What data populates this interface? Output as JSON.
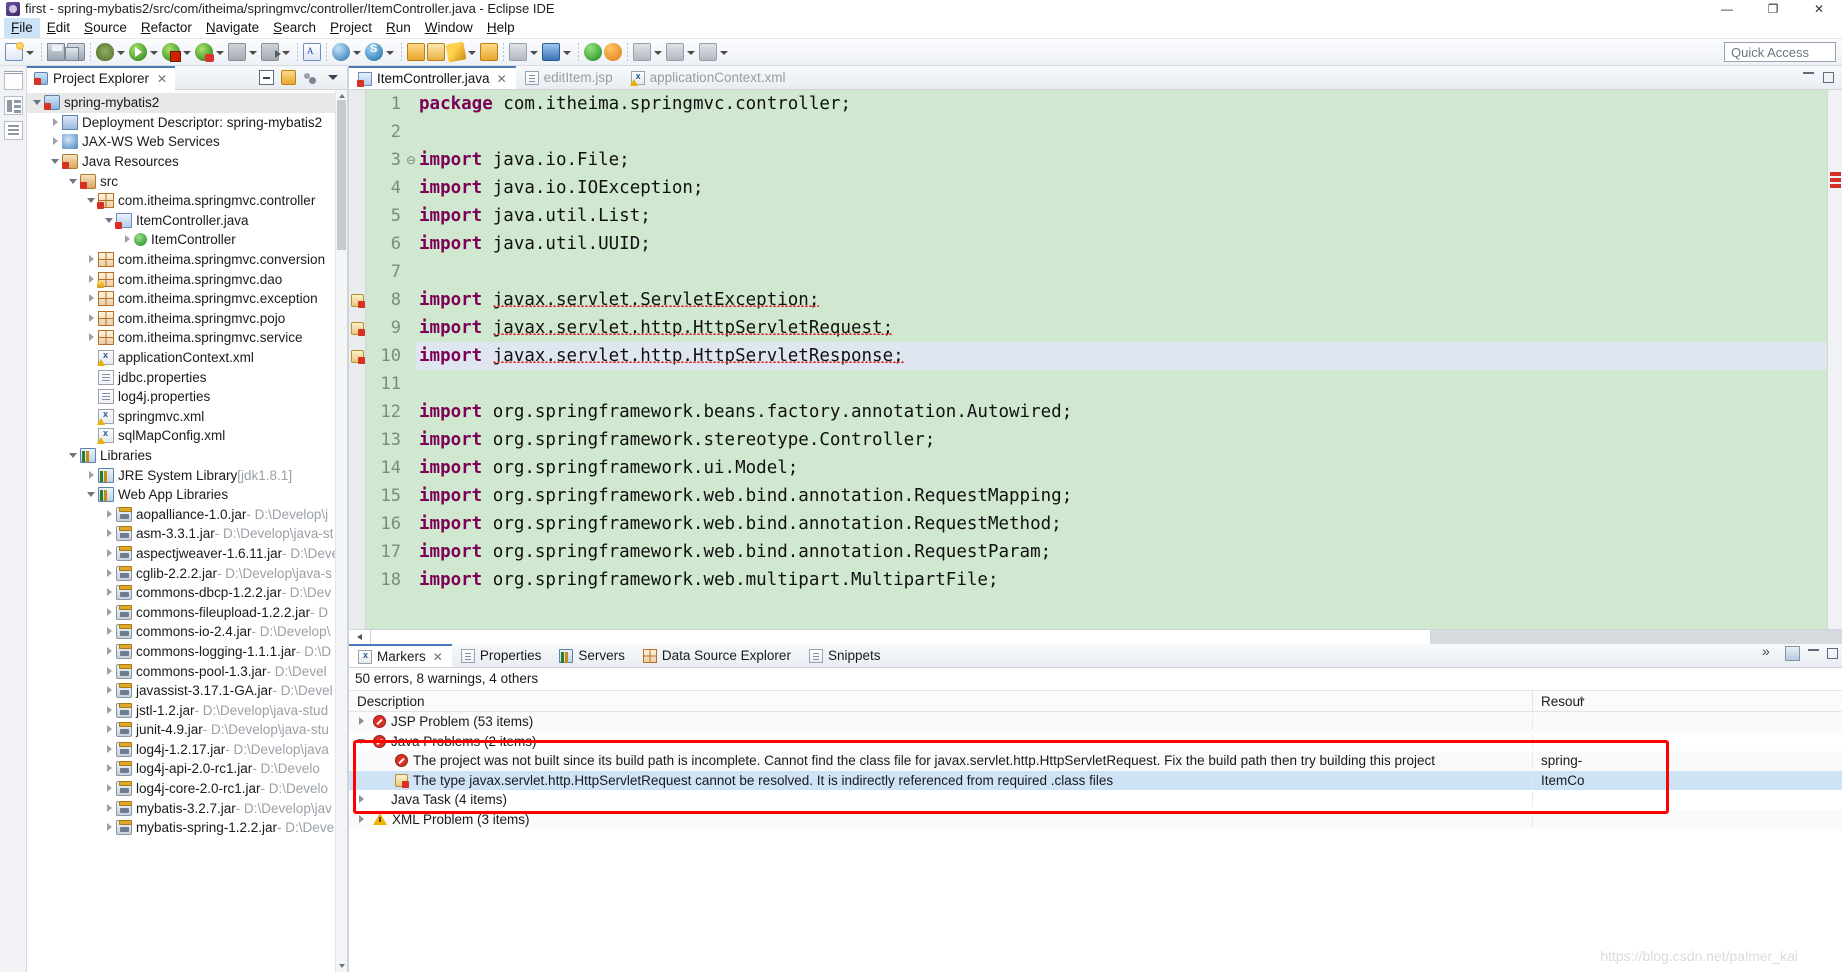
{
  "window": {
    "title": "first - spring-mybatis2/src/com/itheima/springmvc/controller/ItemController.java - Eclipse IDE",
    "minimize": "—",
    "maximize": "❐",
    "close": "✕"
  },
  "menubar": {
    "items": [
      {
        "label": "File",
        "active": true
      },
      {
        "label": "Edit",
        "active": false
      },
      {
        "label": "Source",
        "active": false
      },
      {
        "label": "Refactor",
        "active": false
      },
      {
        "label": "Navigate",
        "active": false
      },
      {
        "label": "Search",
        "active": false
      },
      {
        "label": "Project",
        "active": false
      },
      {
        "label": "Run",
        "active": false
      },
      {
        "label": "Window",
        "active": false
      },
      {
        "label": "Help",
        "active": false
      }
    ]
  },
  "toolbar": {
    "quick_access": "Quick Access",
    "icons": [
      "new-wizard-icon",
      "save-icon",
      "save-all-icon",
      "debug-icon",
      "run-icon",
      "run-configuration-icon",
      "run-as-server-icon",
      "terminate-icon",
      "step-icon",
      "new-java-class-icon",
      "open-type-icon",
      "search-icon",
      "open-resource-icon",
      "folder-icon",
      "pencil-icon",
      "open-perspective-icon"
    ]
  },
  "explorer": {
    "tab_label": "Project Explorer",
    "tab_close": "✕",
    "tools": [
      "collapse-all-icon",
      "link-with-editor-icon",
      "view-menu-dots-icon",
      "view-menu-icon"
    ],
    "tree": [
      {
        "indent": 0,
        "twisty": "expanded",
        "icon": "project-icon",
        "label": "spring-mybatis2",
        "path": "",
        "selected": true
      },
      {
        "indent": 1,
        "twisty": "collapsed",
        "icon": "deployment-descriptor-icon",
        "label": "Deployment Descriptor: spring-mybatis2",
        "path": ""
      },
      {
        "indent": 1,
        "twisty": "collapsed",
        "icon": "web-service-icon",
        "label": "JAX-WS Web Services",
        "path": ""
      },
      {
        "indent": 1,
        "twisty": "expanded",
        "icon": "java-resources-icon",
        "label": "Java Resources",
        "path": ""
      },
      {
        "indent": 2,
        "twisty": "expanded",
        "icon": "source-folder-icon",
        "label": "src",
        "path": ""
      },
      {
        "indent": 3,
        "twisty": "expanded",
        "icon": "package-error-icon",
        "label": "com.itheima.springmvc.controller",
        "path": ""
      },
      {
        "indent": 4,
        "twisty": "expanded",
        "icon": "java-file-error-icon",
        "label": "ItemController.java",
        "path": ""
      },
      {
        "indent": 5,
        "twisty": "collapsed",
        "icon": "class-icon",
        "label": "ItemController",
        "path": ""
      },
      {
        "indent": 3,
        "twisty": "collapsed",
        "icon": "package-icon",
        "label": "com.itheima.springmvc.conversion",
        "path": ""
      },
      {
        "indent": 3,
        "twisty": "collapsed",
        "icon": "package-lock-icon",
        "label": "com.itheima.springmvc.dao",
        "path": ""
      },
      {
        "indent": 3,
        "twisty": "collapsed",
        "icon": "package-icon",
        "label": "com.itheima.springmvc.exception",
        "path": ""
      },
      {
        "indent": 3,
        "twisty": "collapsed",
        "icon": "package-icon",
        "label": "com.itheima.springmvc.pojo",
        "path": ""
      },
      {
        "indent": 3,
        "twisty": "collapsed",
        "icon": "package-icon",
        "label": "com.itheima.springmvc.service",
        "path": ""
      },
      {
        "indent": 3,
        "twisty": "none",
        "icon": "xml-warning-icon",
        "label": "applicationContext.xml",
        "path": ""
      },
      {
        "indent": 3,
        "twisty": "none",
        "icon": "properties-icon",
        "label": "jdbc.properties",
        "path": ""
      },
      {
        "indent": 3,
        "twisty": "none",
        "icon": "properties-icon",
        "label": "log4j.properties",
        "path": ""
      },
      {
        "indent": 3,
        "twisty": "none",
        "icon": "xml-warning-icon",
        "label": "springmvc.xml",
        "path": ""
      },
      {
        "indent": 3,
        "twisty": "none",
        "icon": "xml-warning-icon",
        "label": "sqlMapConfig.xml",
        "path": ""
      },
      {
        "indent": 2,
        "twisty": "expanded",
        "icon": "library-icon",
        "label": "Libraries",
        "path": ""
      },
      {
        "indent": 3,
        "twisty": "collapsed",
        "icon": "library-icon",
        "label": "JRE System Library",
        "path": " [jdk1.8.1]"
      },
      {
        "indent": 3,
        "twisty": "expanded",
        "icon": "library-icon",
        "label": "Web App Libraries",
        "path": ""
      },
      {
        "indent": 4,
        "twisty": "collapsed",
        "icon": "jar-icon",
        "label": "aopalliance-1.0.jar",
        "path": " - D:\\Develop\\j"
      },
      {
        "indent": 4,
        "twisty": "collapsed",
        "icon": "jar-icon",
        "label": "asm-3.3.1.jar",
        "path": " - D:\\Develop\\java-st"
      },
      {
        "indent": 4,
        "twisty": "collapsed",
        "icon": "jar-icon",
        "label": "aspectjweaver-1.6.11.jar",
        "path": " - D:\\Deve"
      },
      {
        "indent": 4,
        "twisty": "collapsed",
        "icon": "jar-icon",
        "label": "cglib-2.2.2.jar",
        "path": " - D:\\Develop\\java-s"
      },
      {
        "indent": 4,
        "twisty": "collapsed",
        "icon": "jar-icon",
        "label": "commons-dbcp-1.2.2.jar",
        "path": " - D:\\Dev"
      },
      {
        "indent": 4,
        "twisty": "collapsed",
        "icon": "jar-icon",
        "label": "commons-fileupload-1.2.2.jar",
        "path": " - D"
      },
      {
        "indent": 4,
        "twisty": "collapsed",
        "icon": "jar-icon",
        "label": "commons-io-2.4.jar",
        "path": " - D:\\Develop\\"
      },
      {
        "indent": 4,
        "twisty": "collapsed",
        "icon": "jar-icon",
        "label": "commons-logging-1.1.1.jar",
        "path": " - D:\\D"
      },
      {
        "indent": 4,
        "twisty": "collapsed",
        "icon": "jar-icon",
        "label": "commons-pool-1.3.jar",
        "path": " - D:\\Devel"
      },
      {
        "indent": 4,
        "twisty": "collapsed",
        "icon": "jar-icon",
        "label": "javassist-3.17.1-GA.jar",
        "path": " - D:\\Devel"
      },
      {
        "indent": 4,
        "twisty": "collapsed",
        "icon": "jar-icon",
        "label": "jstl-1.2.jar",
        "path": " - D:\\Develop\\java-stud"
      },
      {
        "indent": 4,
        "twisty": "collapsed",
        "icon": "jar-icon",
        "label": "junit-4.9.jar",
        "path": " - D:\\Develop\\java-stu"
      },
      {
        "indent": 4,
        "twisty": "collapsed",
        "icon": "jar-icon",
        "label": "log4j-1.2.17.jar",
        "path": " - D:\\Develop\\java"
      },
      {
        "indent": 4,
        "twisty": "collapsed",
        "icon": "jar-icon",
        "label": "log4j-api-2.0-rc1.jar",
        "path": " - D:\\Develo"
      },
      {
        "indent": 4,
        "twisty": "collapsed",
        "icon": "jar-icon",
        "label": "log4j-core-2.0-rc1.jar",
        "path": " - D:\\Develo"
      },
      {
        "indent": 4,
        "twisty": "collapsed",
        "icon": "jar-icon",
        "label": "mybatis-3.2.7.jar",
        "path": " - D:\\Develop\\jav"
      },
      {
        "indent": 4,
        "twisty": "collapsed",
        "icon": "jar-icon",
        "label": "mybatis-spring-1.2.2.jar",
        "path": " - D:\\Deve"
      }
    ]
  },
  "editor": {
    "tabs": [
      {
        "label": "ItemController.java",
        "icon": "java-file-error-icon",
        "active": true,
        "close": "✕"
      },
      {
        "label": "editItem.jsp",
        "icon": "jsp-file-icon",
        "active": false
      },
      {
        "label": "applicationContext.xml",
        "icon": "xml-file-icon",
        "active": false
      }
    ],
    "lines": [
      {
        "num": "1",
        "fold": "",
        "marker": "",
        "current": false,
        "error": false,
        "segments": [
          {
            "t": "package",
            "kw": true
          },
          {
            "t": " com.itheima.springmvc.controller;",
            "kw": false
          }
        ]
      },
      {
        "num": "2",
        "fold": "",
        "marker": "",
        "current": false,
        "error": false,
        "segments": []
      },
      {
        "num": "3",
        "fold": "⊖",
        "marker": "",
        "current": false,
        "error": false,
        "segments": [
          {
            "t": "import",
            "kw": true
          },
          {
            "t": " java.io.File;",
            "kw": false
          }
        ]
      },
      {
        "num": "4",
        "fold": "",
        "marker": "",
        "current": false,
        "error": false,
        "segments": [
          {
            "t": "import",
            "kw": true
          },
          {
            "t": " java.io.IOException;",
            "kw": false
          }
        ]
      },
      {
        "num": "5",
        "fold": "",
        "marker": "",
        "current": false,
        "error": false,
        "segments": [
          {
            "t": "import",
            "kw": true
          },
          {
            "t": " java.util.List;",
            "kw": false
          }
        ]
      },
      {
        "num": "6",
        "fold": "",
        "marker": "",
        "current": false,
        "error": false,
        "segments": [
          {
            "t": "import",
            "kw": true
          },
          {
            "t": " java.util.UUID;",
            "kw": false
          }
        ]
      },
      {
        "num": "7",
        "fold": "",
        "marker": "",
        "current": false,
        "error": false,
        "segments": []
      },
      {
        "num": "8",
        "fold": "",
        "marker": "error",
        "current": false,
        "error": true,
        "segments": [
          {
            "t": "import",
            "kw": true
          },
          {
            "t": " ",
            "kw": false
          },
          {
            "t": "javax.servlet.ServletException;",
            "kw": false,
            "err": true
          }
        ]
      },
      {
        "num": "9",
        "fold": "",
        "marker": "error",
        "current": false,
        "error": true,
        "segments": [
          {
            "t": "import",
            "kw": true
          },
          {
            "t": " ",
            "kw": false
          },
          {
            "t": "javax.servlet.http.HttpServletRequest;",
            "kw": false,
            "err": true
          }
        ]
      },
      {
        "num": "10",
        "fold": "",
        "marker": "error",
        "current": true,
        "error": true,
        "segments": [
          {
            "t": "import",
            "kw": true
          },
          {
            "t": " ",
            "kw": false
          },
          {
            "t": "javax.servlet.http.HttpServletResponse;",
            "kw": false,
            "err": true
          }
        ]
      },
      {
        "num": "11",
        "fold": "",
        "marker": "",
        "current": false,
        "error": false,
        "segments": []
      },
      {
        "num": "12",
        "fold": "",
        "marker": "",
        "current": false,
        "error": false,
        "segments": [
          {
            "t": "import",
            "kw": true
          },
          {
            "t": " org.springframework.beans.factory.annotation.Autowired;",
            "kw": false
          }
        ]
      },
      {
        "num": "13",
        "fold": "",
        "marker": "",
        "current": false,
        "error": false,
        "segments": [
          {
            "t": "import",
            "kw": true
          },
          {
            "t": " org.springframework.stereotype.Controller;",
            "kw": false
          }
        ]
      },
      {
        "num": "14",
        "fold": "",
        "marker": "",
        "current": false,
        "error": false,
        "segments": [
          {
            "t": "import",
            "kw": true
          },
          {
            "t": " org.springframework.ui.Model;",
            "kw": false
          }
        ]
      },
      {
        "num": "15",
        "fold": "",
        "marker": "",
        "current": false,
        "error": false,
        "segments": [
          {
            "t": "import",
            "kw": true
          },
          {
            "t": " org.springframework.web.bind.annotation.RequestMapping;",
            "kw": false
          }
        ]
      },
      {
        "num": "16",
        "fold": "",
        "marker": "",
        "current": false,
        "error": false,
        "segments": [
          {
            "t": "import",
            "kw": true
          },
          {
            "t": " org.springframework.web.bind.annotation.RequestMethod;",
            "kw": false
          }
        ]
      },
      {
        "num": "17",
        "fold": "",
        "marker": "",
        "current": false,
        "error": false,
        "segments": [
          {
            "t": "import",
            "kw": true
          },
          {
            "t": " org.springframework.web.bind.annotation.RequestParam;",
            "kw": false
          }
        ]
      },
      {
        "num": "18",
        "fold": "",
        "marker": "",
        "current": false,
        "error": false,
        "segments": [
          {
            "t": "import",
            "kw": true
          },
          {
            "t": " org.springframework.web.multipart.MultipartFile;",
            "kw": false
          }
        ]
      }
    ]
  },
  "markers": {
    "tabs": [
      {
        "label": "Markers",
        "icon": "markers-icon",
        "active": true,
        "close": "✕"
      },
      {
        "label": "Properties",
        "icon": "properties-view-icon",
        "active": false
      },
      {
        "label": "Servers",
        "icon": "servers-icon",
        "active": false
      },
      {
        "label": "Data Source Explorer",
        "icon": "data-source-icon",
        "active": false
      },
      {
        "label": "Snippets",
        "icon": "snippets-icon",
        "active": false
      }
    ],
    "summary": "50 errors, 8 warnings, 4 others",
    "columns": {
      "description": "Description",
      "resource": "Resour"
    },
    "sort_indicator": "^",
    "rows": [
      {
        "indent": 0,
        "twisty": "collapsed",
        "icon": "error-icon",
        "description": "JSP Problem (53 items)",
        "resource": "",
        "selected": false,
        "alt": false
      },
      {
        "indent": 0,
        "twisty": "expanded",
        "icon": "error-icon",
        "description": "Java Problems (2 items)",
        "resource": "",
        "selected": false,
        "alt": true
      },
      {
        "indent": 1,
        "twisty": "none",
        "icon": "error-icon",
        "description": "The project was not built since its build path is incomplete. Cannot find the class file for javax.servlet.http.HttpServletRequest. Fix the build path then try building this project",
        "resource": "spring-",
        "selected": false,
        "alt": false
      },
      {
        "indent": 1,
        "twisty": "none",
        "icon": "build-path-problem-icon",
        "description": "The type javax.servlet.http.HttpServletRequest cannot be resolved. It is indirectly referenced from required .class files",
        "resource": "ItemCo",
        "selected": true,
        "alt": false
      },
      {
        "indent": 0,
        "twisty": "collapsed",
        "icon": "none",
        "description": "Java Task (4 items)",
        "resource": "",
        "selected": false,
        "alt": true
      },
      {
        "indent": 0,
        "twisty": "collapsed",
        "icon": "warning-icon",
        "description": "XML Problem (3 items)",
        "resource": "",
        "selected": false,
        "alt": false
      }
    ],
    "watermark": "https://blog.csdn.net/palmer_kai"
  }
}
